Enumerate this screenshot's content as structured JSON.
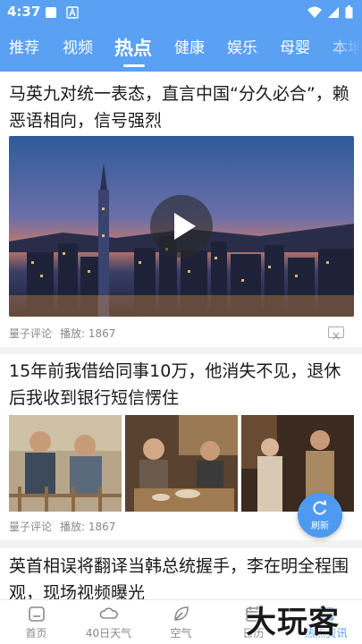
{
  "status_bar": {
    "time": "4:37"
  },
  "tabs": [
    {
      "label": "推荐",
      "active": false
    },
    {
      "label": "视频",
      "active": false
    },
    {
      "label": "热点",
      "active": true
    },
    {
      "label": "健康",
      "active": false
    },
    {
      "label": "娱乐",
      "active": false
    },
    {
      "label": "母婴",
      "active": false
    },
    {
      "label": "本地",
      "active": false
    }
  ],
  "articles": [
    {
      "title": "马英九对统一表态，直言中国“分久必合”，赖恶语相向，信号强烈",
      "source": "量子评论",
      "plays": "播放: 1867",
      "media": "video"
    },
    {
      "title": "15年前我借给同事10万，他消失不见，退休后我收到银行短信愣住",
      "source": "量子评论",
      "plays": "播放: 1867",
      "media": "three-images"
    },
    {
      "title": "英首相误将翻译当韩总统握手，李在明全程围观，现场视频曝光",
      "media": "none"
    }
  ],
  "refresh_button": {
    "label": "刷新"
  },
  "bottom_nav": [
    {
      "label": "首页",
      "icon": "home-icon",
      "active": false
    },
    {
      "label": "40日天气",
      "icon": "cloud-icon",
      "active": false
    },
    {
      "label": "空气",
      "icon": "leaf-icon",
      "active": false
    },
    {
      "label": "日历",
      "icon": "calendar-icon",
      "active": false
    },
    {
      "label": "热点资讯",
      "icon": "news-icon",
      "active": true
    }
  ],
  "watermark": "大玩客",
  "colors": {
    "accent": "#5aa0f3",
    "nav_active": "#4e9af1"
  }
}
